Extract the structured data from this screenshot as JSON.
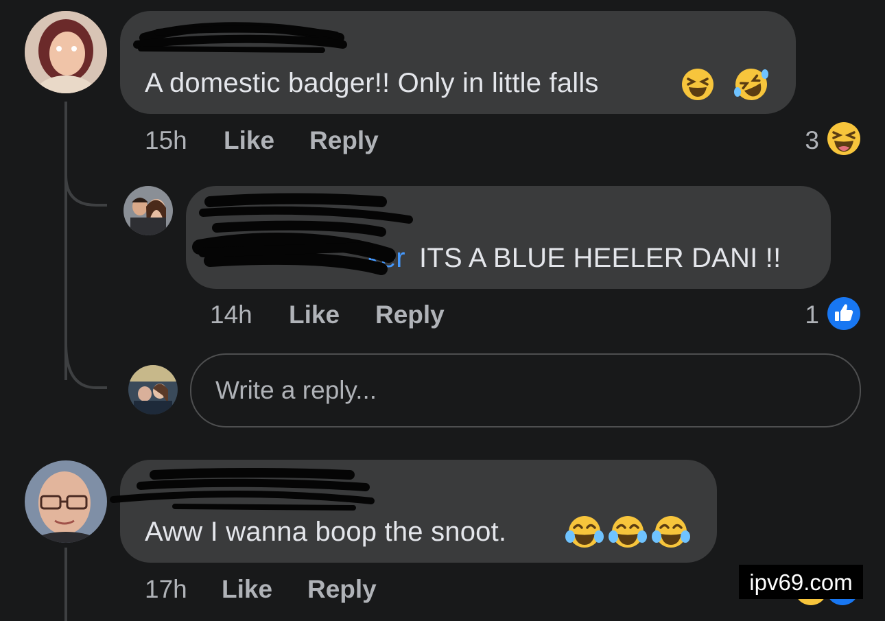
{
  "comments": [
    {
      "text": "A domestic badger!! Only in little falls",
      "emojis": [
        "laughing-squint-emoji",
        "rofl-emoji"
      ],
      "time": "15h",
      "like_label": "Like",
      "reply_label": "Reply",
      "reaction_count": "3",
      "reaction_icon": "laughing-squint-emoji"
    },
    {
      "mention_fragment": "ker",
      "text": "ITS A BLUE HEELER DANI !!",
      "time": "14h",
      "like_label": "Like",
      "reply_label": "Reply",
      "reaction_count": "1",
      "reaction_icon": "like-thumb-icon"
    },
    {
      "text": "Aww I wanna boop the snoot.",
      "emojis": [
        "tears-of-joy-emoji",
        "tears-of-joy-emoji",
        "tears-of-joy-emoji"
      ],
      "time": "17h",
      "like_label": "Like",
      "reply_label": "Reply"
    }
  ],
  "reply_box": {
    "placeholder": "Write a reply..."
  },
  "watermark": "ipv69.com",
  "colors": {
    "background": "#18191a",
    "bubble": "#3a3b3c",
    "text": "#e4e6eb",
    "meta": "#b0b3b8",
    "mention": "#4599ff",
    "like_blue": "#1877f2",
    "emoji_yellow": "#f7c53c"
  }
}
